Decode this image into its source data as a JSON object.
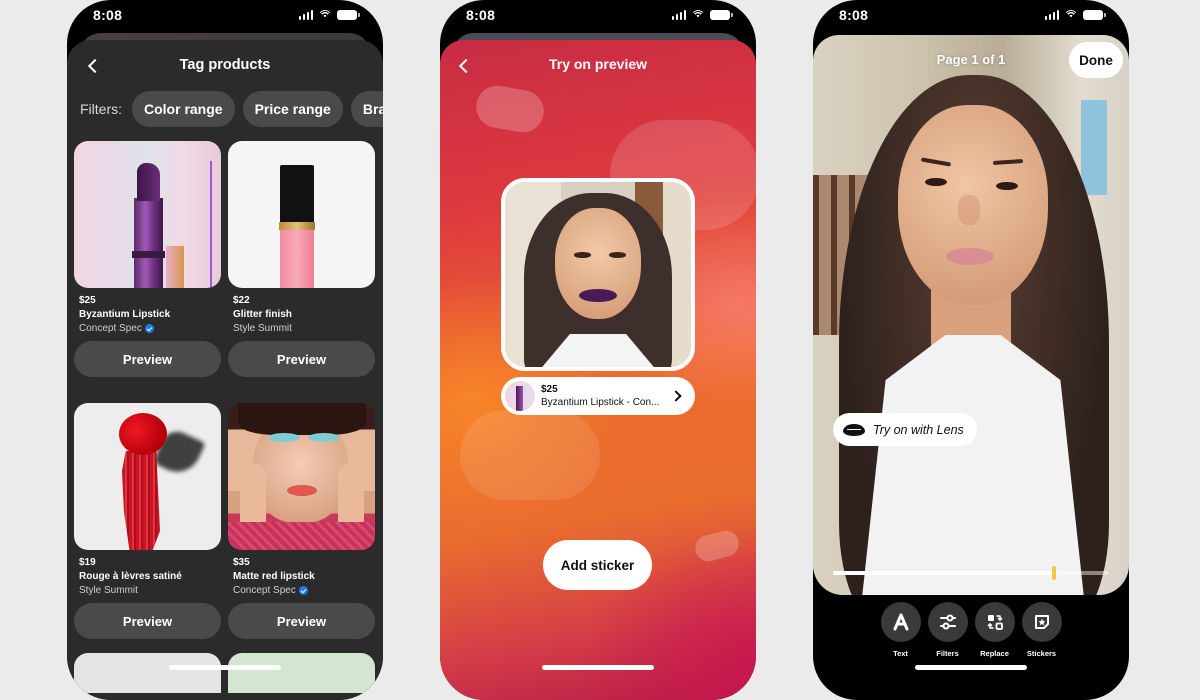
{
  "status_bar": {
    "time": "8:08"
  },
  "tag_products": {
    "title": "Tag products",
    "filters_label": "Filters:",
    "filters": [
      "Color range",
      "Price range",
      "Brand"
    ],
    "products": [
      {
        "price": "$25",
        "name": "Byzantium Lipstick",
        "brand": "Concept Spec",
        "verified": true,
        "button": "Preview"
      },
      {
        "price": "$22",
        "name": "Glitter finish",
        "brand": "Style Summit",
        "verified": false,
        "button": "Preview"
      },
      {
        "price": "$19",
        "name": "Rouge à lèvres satiné",
        "brand": "Style Summit",
        "verified": false,
        "button": "Preview"
      },
      {
        "price": "$35",
        "name": "Matte red lipstick",
        "brand": "Concept Spec",
        "verified": true,
        "button": "Preview"
      }
    ]
  },
  "try_on_preview": {
    "title": "Try on preview",
    "tagged_product": {
      "price": "$25",
      "name": "Byzantium Lipstick - Con..."
    },
    "lip_color": "#4a1a55",
    "add_sticker": "Add sticker"
  },
  "editor": {
    "page_label": "Page 1 of 1",
    "done": "Done",
    "lens_label": "Try on with Lens",
    "scrubber_position": 0.8,
    "tools": [
      {
        "icon": "text-icon",
        "label": "Text"
      },
      {
        "icon": "filters-icon",
        "label": "Filters"
      },
      {
        "icon": "replace-icon",
        "label": "Replace"
      },
      {
        "icon": "stickers-icon",
        "label": "Stickers"
      }
    ]
  },
  "colors": {
    "background": "#ebebeb",
    "sheet": "#2b2b2b",
    "chip": "#4a4a4a",
    "verified": "#1f7cf0",
    "scrubber_handle": "#f4c542"
  }
}
